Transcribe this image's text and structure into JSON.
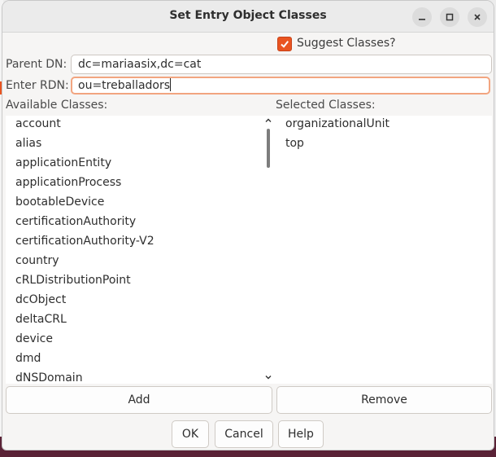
{
  "window": {
    "title": "Set Entry Object Classes"
  },
  "suggest": {
    "label": "Suggest Classes?",
    "checked": true
  },
  "parent_dn": {
    "label": "Parent DN:",
    "value": "dc=mariaasix,dc=cat"
  },
  "rdn": {
    "label": "Enter RDN:",
    "value": "ou=treballadors"
  },
  "available": {
    "label": "Available Classes:",
    "items": [
      "account",
      "alias",
      "applicationEntity",
      "applicationProcess",
      "bootableDevice",
      "certificationAuthority",
      "certificationAuthority-V2",
      "country",
      "cRLDistributionPoint",
      "dcObject",
      "deltaCRL",
      "device",
      "dmd",
      "dNSDomain"
    ]
  },
  "selected": {
    "label": "Selected Classes:",
    "items": [
      "organizationalUnit",
      "top"
    ]
  },
  "buttons": {
    "add": "Add",
    "remove": "Remove",
    "ok": "OK",
    "cancel": "Cancel",
    "help": "Help"
  },
  "colors": {
    "accent": "#e95420",
    "focus_ring": "#f2a580"
  },
  "icons": {
    "minimize": "minimize-icon",
    "maximize": "maximize-icon",
    "close": "close-icon",
    "check": "checkmark-icon"
  }
}
